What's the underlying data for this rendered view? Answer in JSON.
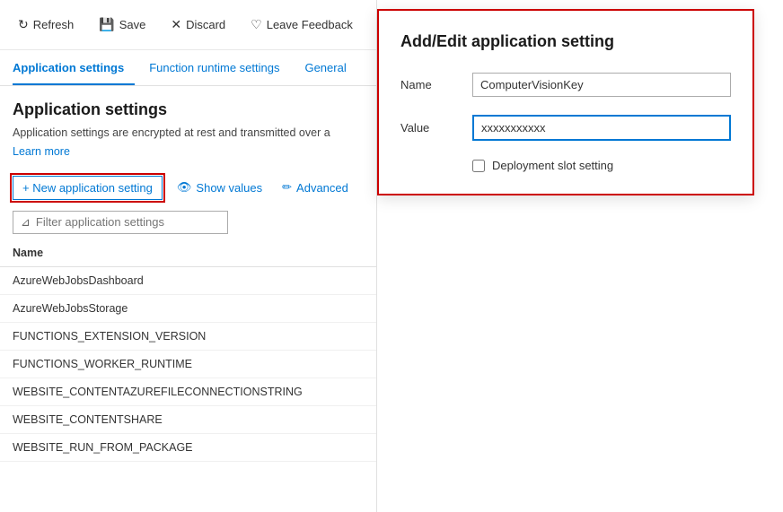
{
  "toolbar": {
    "refresh_label": "Refresh",
    "save_label": "Save",
    "discard_label": "Discard",
    "feedback_label": "Leave Feedback"
  },
  "tabs": {
    "tab1": "Application settings",
    "tab2": "Function runtime settings",
    "tab3": "General"
  },
  "section": {
    "heading": "Application settings",
    "description": "Application settings are encrypted at rest and transmitted over a",
    "learn_more": "Learn more"
  },
  "actions": {
    "new_setting": "+ New application setting",
    "show_values": "Show values",
    "advanced": "Advanced"
  },
  "filter": {
    "placeholder": "Filter application settings"
  },
  "table": {
    "column_name": "Name",
    "rows": [
      "AzureWebJobsDashboard",
      "AzureWebJobsStorage",
      "FUNCTIONS_EXTENSION_VERSION",
      "FUNCTIONS_WORKER_RUNTIME",
      "WEBSITE_CONTENTAZUREFILECONNECTIONSTRING",
      "WEBSITE_CONTENTSHARE",
      "WEBSITE_RUN_FROM_PACKAGE"
    ]
  },
  "modal": {
    "title": "Add/Edit application setting",
    "name_label": "Name",
    "name_value": "ComputerVisionKey",
    "value_label": "Value",
    "value_value": "xxxxxxxxxxx",
    "checkbox_label": "Deployment slot setting"
  }
}
